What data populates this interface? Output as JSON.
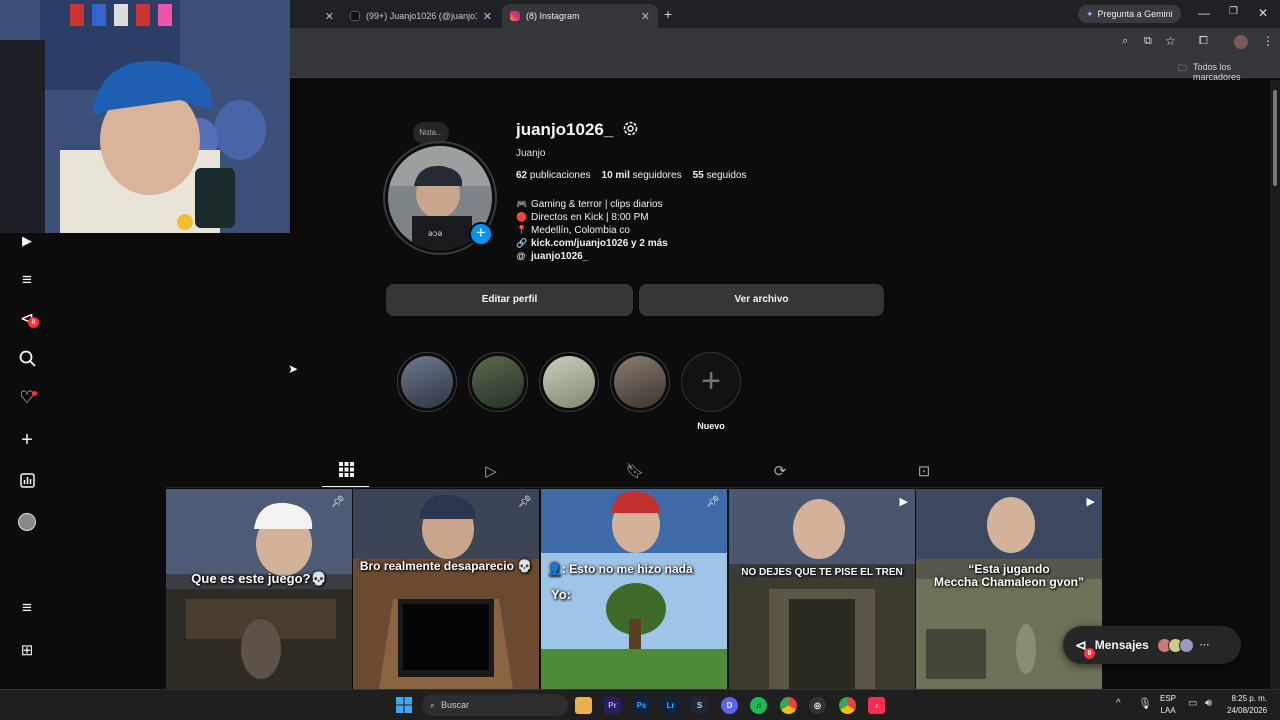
{
  "browser": {
    "tabs": [
      {
        "title": "",
        "active": false
      },
      {
        "title": "(99+) Juanjo1026 (@juanjo1026",
        "active": false
      },
      {
        "title": "(8) Instagram",
        "active": true
      }
    ],
    "new_tab": "+",
    "gemini_label": "Pregunta a Gemini",
    "bookmarks_label": "Todos los marcadores"
  },
  "sidebar": {
    "notification_badge": "8"
  },
  "profile": {
    "note_label": "Nota...",
    "username": "juanjo1026_",
    "full_name": "Juanjo",
    "stats": {
      "posts_count": "62",
      "posts_label": "publicaciones",
      "followers_count": "10 mil",
      "followers_label": "seguidores",
      "following_count": "55",
      "following_label": "seguidos"
    },
    "bio": [
      {
        "icon": "🎮",
        "text": "Gaming & terror | clips diarios"
      },
      {
        "icon": "🔴",
        "text": "Directos en Kick | 8:00 PM"
      },
      {
        "icon": "📍",
        "text": "Medellín, Colombia co"
      }
    ],
    "link": "kick.com/juanjo1026 y 2 más",
    "threads": "juanjo1026_",
    "edit_profile_label": "Editar perfil",
    "archive_label": "Ver archivo"
  },
  "highlights": {
    "new_label": "Nuevo"
  },
  "posts": [
    {
      "caption": "Que es este juego?💀",
      "badge": "pin"
    },
    {
      "caption": "Bro realmente desaparecio 💀",
      "badge": "pin"
    },
    {
      "caption": "👤: Esto no me hizo nada",
      "caption2": "Yo:",
      "badge": "pin"
    },
    {
      "caption": "NO DEJES QUE TE PISE EL TREN",
      "badge": "reel"
    },
    {
      "caption": "“Esta jugando",
      "caption2": "Meccha Chamaleon gvon”",
      "badge": "reel"
    }
  ],
  "messages": {
    "label": "Mensajes",
    "badge": "8"
  },
  "taskbar": {
    "search_placeholder": "Buscar",
    "lang_1": "ESP",
    "lang_2": "LAA",
    "time": "8:25 p. m.",
    "date": "24/08/2026"
  },
  "colors": {
    "background": "#0c0c0c",
    "button": "#363636",
    "accent_blue": "#0095f6",
    "badge_red": "#ff3040"
  }
}
